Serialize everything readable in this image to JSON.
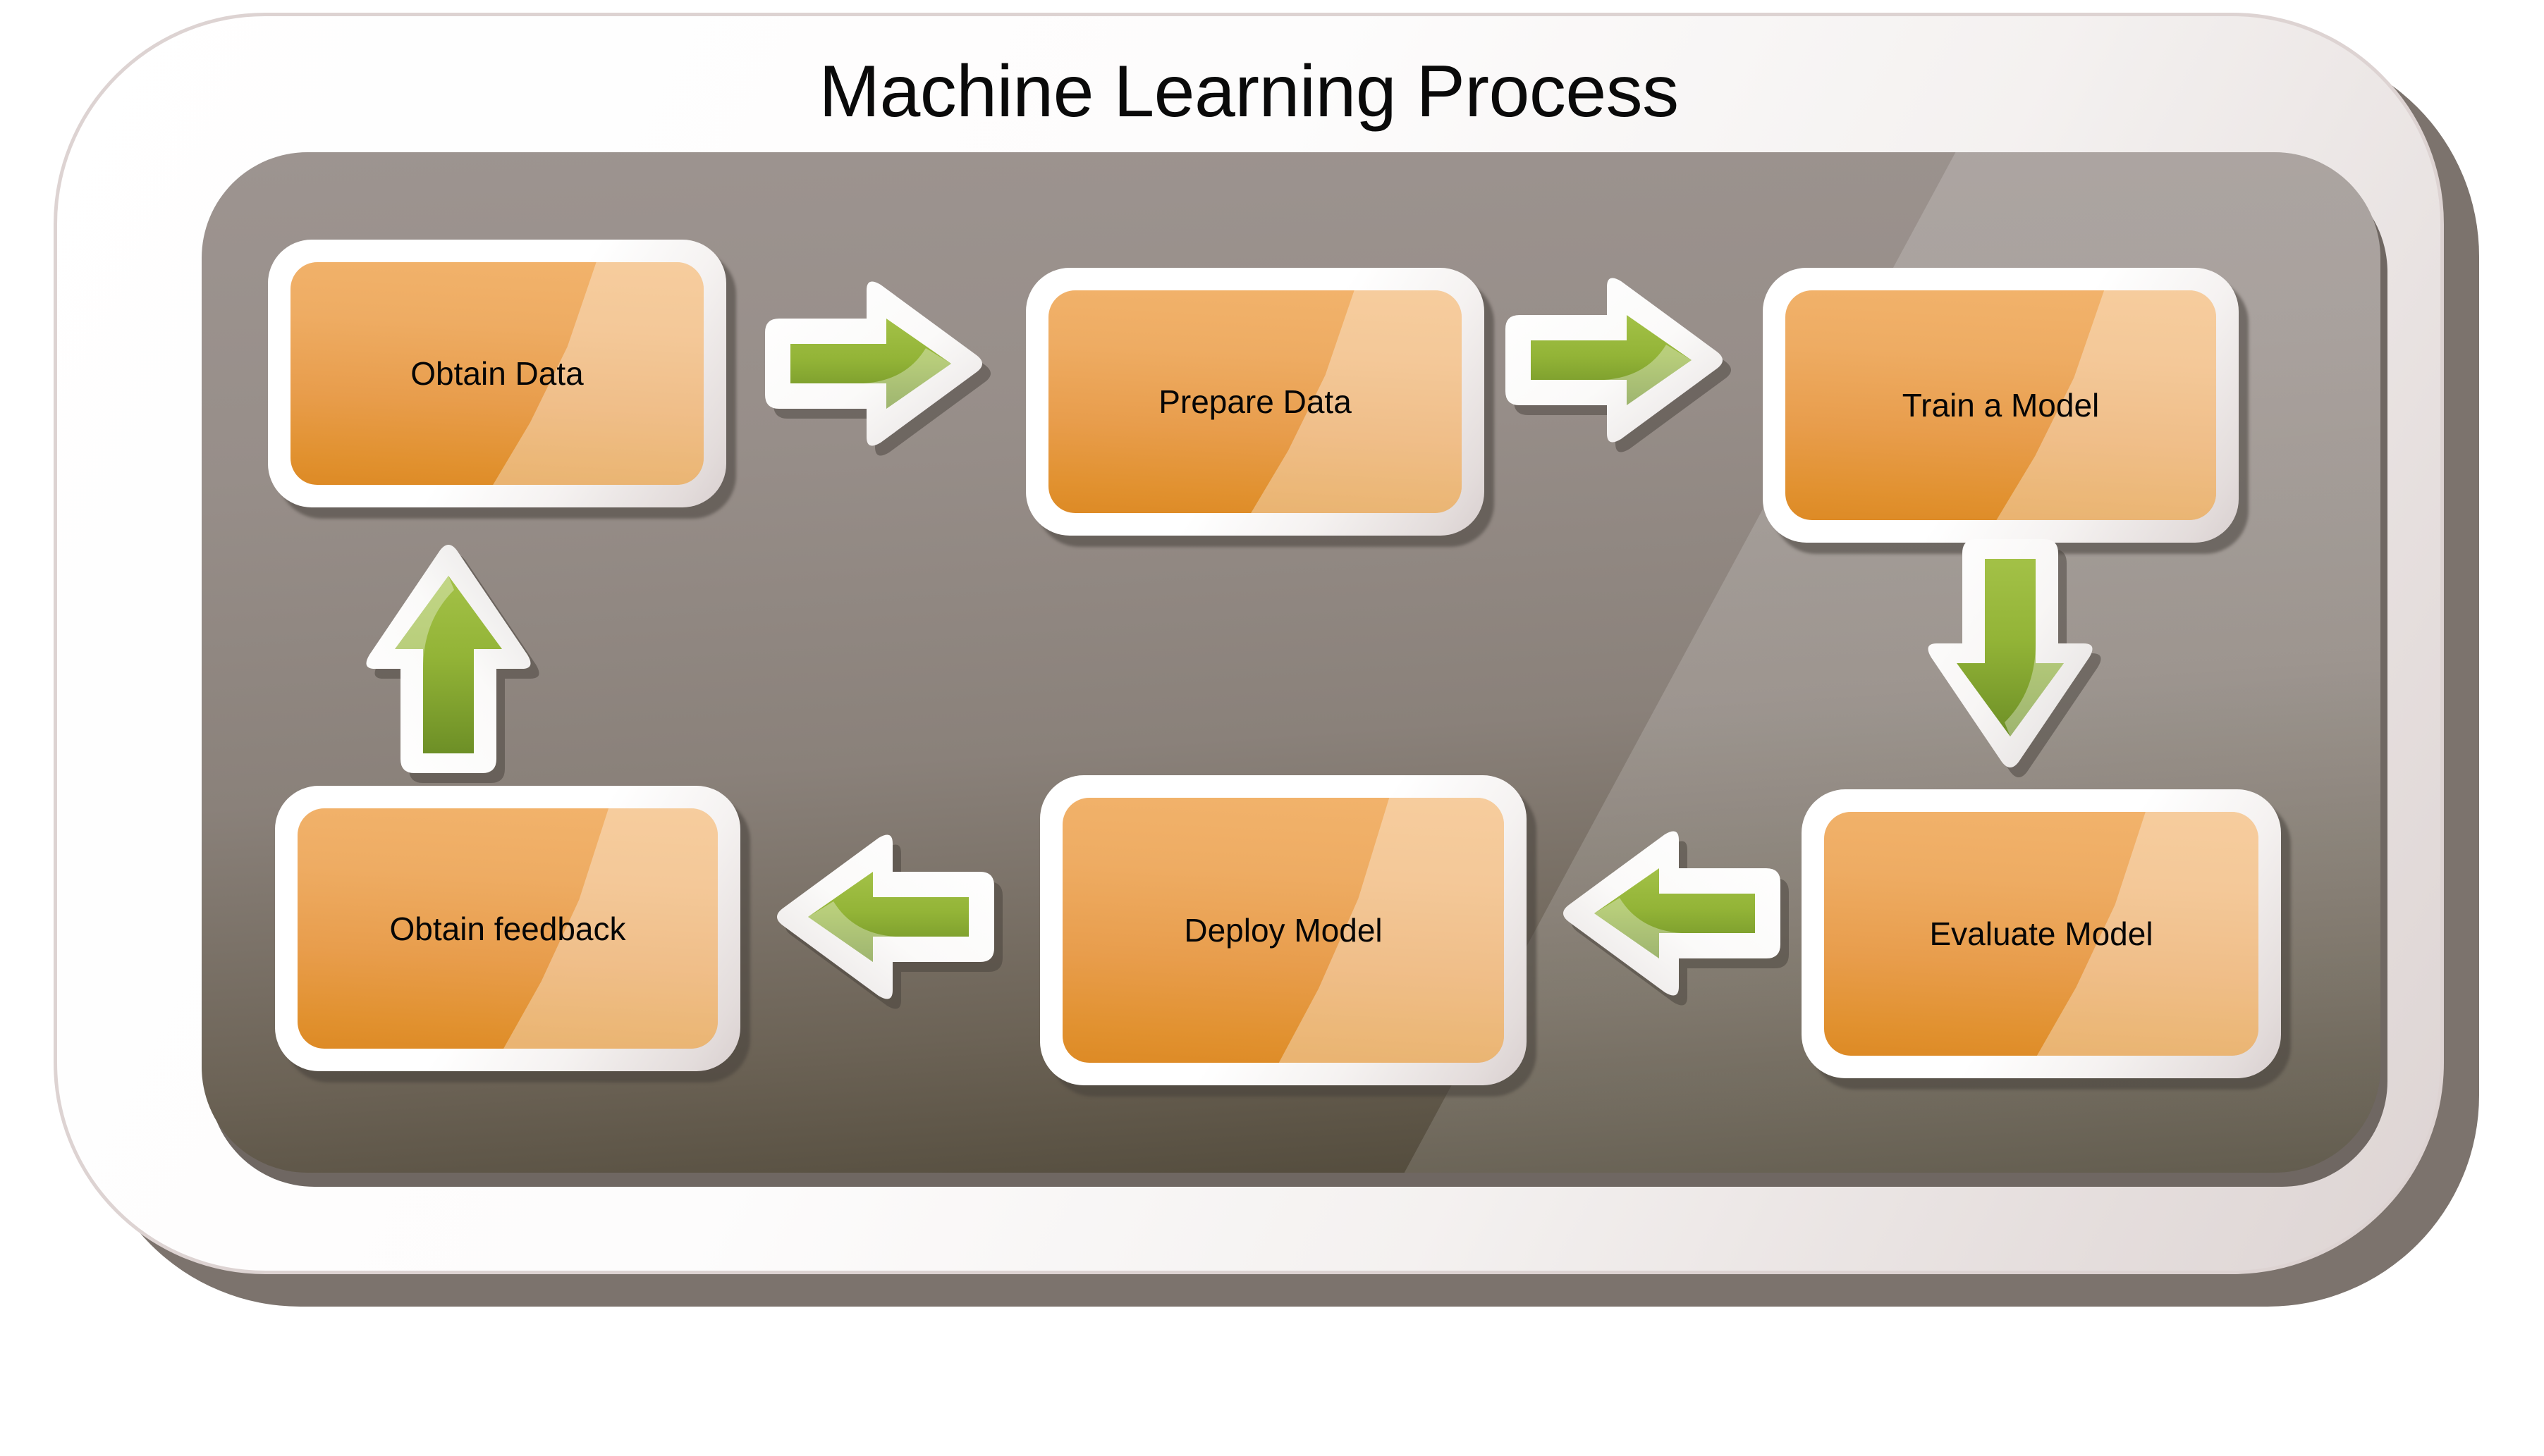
{
  "diagram": {
    "title": "Machine Learning Process",
    "type": "cycle-flowchart",
    "colors": {
      "accent_green_light": "#9ebe3f",
      "accent_green_dark": "#6f9128",
      "node_orange_light": "#f2b36c",
      "node_orange_dark": "#dd8a25",
      "panel_gray": "#978e89",
      "panel_gray_dark": "#4b4434",
      "frame_white": "#ffffff",
      "frame_border": "#ddd3d2",
      "text": "#060606"
    },
    "nodes": [
      {
        "id": "obtain-data",
        "label": "Obtain Data"
      },
      {
        "id": "prepare-data",
        "label": "Prepare Data"
      },
      {
        "id": "train-model",
        "label": "Train a Model"
      },
      {
        "id": "evaluate-model",
        "label": "Evaluate Model"
      },
      {
        "id": "deploy-model",
        "label": "Deploy Model"
      },
      {
        "id": "obtain-feedback",
        "label": "Obtain feedback"
      }
    ],
    "arrows": [
      {
        "id": "obtain-to-prepare",
        "direction": "right",
        "from": "Obtain Data",
        "to": "Prepare Data"
      },
      {
        "id": "prepare-to-train",
        "direction": "right",
        "from": "Prepare Data",
        "to": "Train a Model"
      },
      {
        "id": "train-to-evaluate",
        "direction": "down",
        "from": "Train a Model",
        "to": "Evaluate Model"
      },
      {
        "id": "evaluate-to-deploy",
        "direction": "left",
        "from": "Evaluate Model",
        "to": "Deploy Model"
      },
      {
        "id": "deploy-to-feedback",
        "direction": "left",
        "from": "Deploy Model",
        "to": "Obtain feedback"
      },
      {
        "id": "feedback-to-obtain",
        "direction": "up",
        "from": "Obtain feedback",
        "to": "Obtain Data"
      }
    ]
  }
}
